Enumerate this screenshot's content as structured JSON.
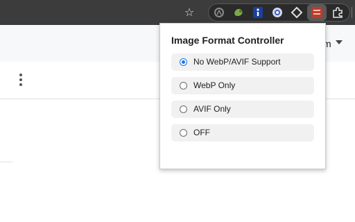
{
  "header": {
    "partial_text": "m"
  },
  "popup": {
    "title": "Image Format Controller",
    "selected_index": 0,
    "options": [
      {
        "label": "No WebP/AVIF Support",
        "checked": true
      },
      {
        "label": "WebP Only",
        "checked": false
      },
      {
        "label": "AVIF Only",
        "checked": false
      },
      {
        "label": "OFF",
        "checked": false
      }
    ]
  },
  "toolbar": {
    "star_glyph": "☆",
    "extensions": [
      {
        "icon": "circle-extension-icon",
        "color": "#8a8a8a"
      },
      {
        "icon": "leaf-extension-icon",
        "color": "#7fa74a"
      },
      {
        "icon": "info-extension-icon",
        "color": "#1b3fa0"
      },
      {
        "icon": "globe-extension-icon",
        "color": "#d0d7ef"
      },
      {
        "icon": "diamond-extension-icon",
        "color": "#e0e0e0"
      },
      {
        "icon": "webp-avif-extension-icon",
        "color": "#c0392b"
      },
      {
        "icon": "puzzle-extensions-icon",
        "color": "#e8e8e8"
      }
    ]
  },
  "colors": {
    "accent": "#1a73e8",
    "toolbar": "#3c3c3c",
    "option_bg": "#f1f1f1"
  }
}
